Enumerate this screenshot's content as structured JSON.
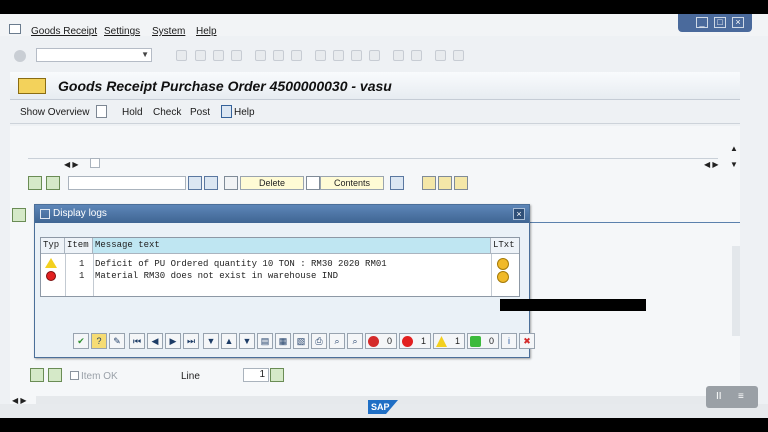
{
  "menu": {
    "items": [
      "Goods Receipt",
      "Settings",
      "System",
      "Help"
    ]
  },
  "window_controls": [
    "_",
    "□",
    "×"
  ],
  "header": {
    "title": "Goods Receipt Purchase Order 4500000030 - vasu"
  },
  "app_toolbar": {
    "show_overview": "Show Overview",
    "hold": "Hold",
    "check": "Check",
    "post": "Post",
    "help": "Help"
  },
  "content_toolbar": {
    "delete_label": "Delete",
    "contents_label": "Contents"
  },
  "dialog": {
    "title": "Display logs",
    "close": "×",
    "columns": [
      "Typ",
      "Item",
      "Message text",
      "LTxt"
    ],
    "rows": [
      {
        "type": "warning",
        "item": "1",
        "text": "Deficit of PU Ordered quantity 10 TON : RM30 2020 RM01"
      },
      {
        "type": "error",
        "item": "1",
        "text": "Material RM30 does not exist in warehouse IND"
      }
    ],
    "counts": {
      "stop": "0",
      "error": "1",
      "warning": "1",
      "success": "0"
    }
  },
  "bottom": {
    "item_ok_label": "Item OK",
    "line_label": "Line",
    "line_value": "1"
  },
  "footer": {
    "brand": "SAP",
    "play": "II",
    "menu": "≡"
  },
  "colors": {
    "dialog_title": "#3f6593",
    "header_msg": "#bfe6f2",
    "warning": "#f3d01f",
    "error": "#e22020",
    "success": "#3cba3c"
  }
}
